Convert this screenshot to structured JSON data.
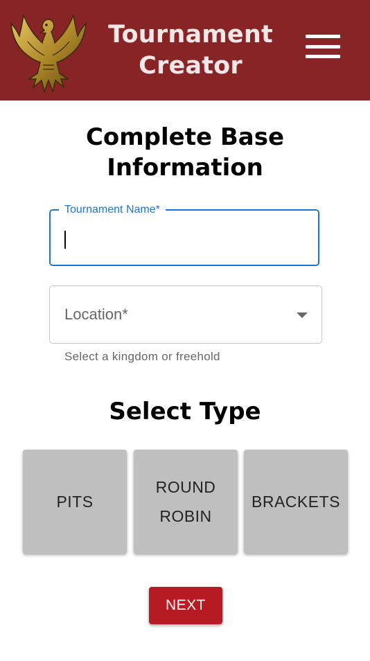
{
  "header": {
    "title_line1": "Tournament",
    "title_line2": "Creator",
    "logo_icon": "eagle-logo",
    "menu_icon": "hamburger-menu-icon",
    "background_color": "#862426"
  },
  "form": {
    "heading_line1": "Complete Base",
    "heading_line2": "Information",
    "tournament_name": {
      "label": "Tournament Name",
      "required_mark": "*",
      "value": ""
    },
    "location": {
      "label": "Location",
      "required_mark": "*",
      "helper": "Select a kingdom or freehold",
      "selected": ""
    }
  },
  "type_section": {
    "heading": "Select Type",
    "options": [
      {
        "label": "PITS"
      },
      {
        "label_line1": "ROUND",
        "label_line2": "ROBIN"
      },
      {
        "label": "BRACKETS"
      }
    ]
  },
  "actions": {
    "next_label": "NEXT",
    "next_color": "#b71c24"
  },
  "colors": {
    "focus_blue": "#1976d2",
    "button_gray": "#bfbfbf"
  }
}
